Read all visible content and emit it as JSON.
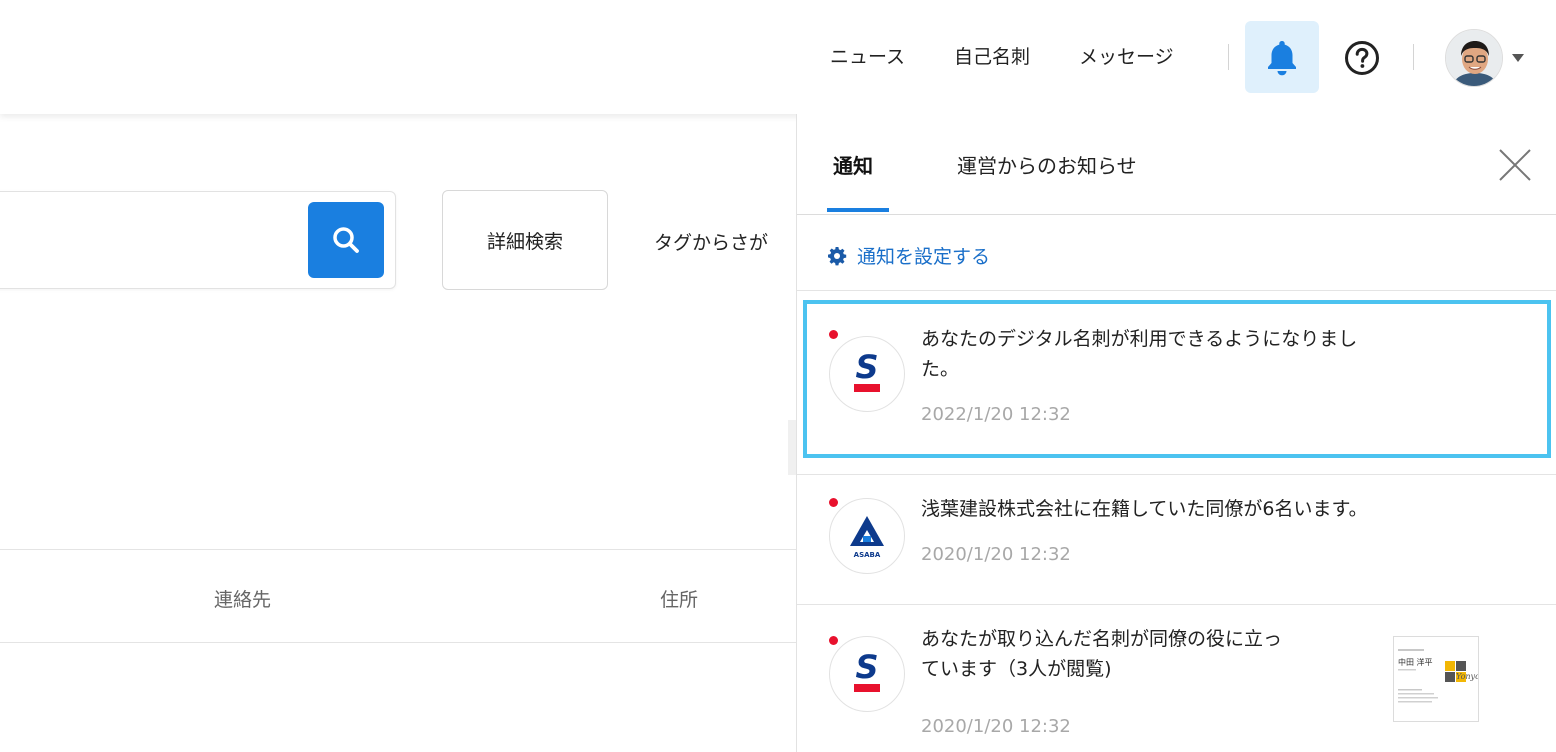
{
  "header": {
    "nav": [
      "ニュース",
      "自己名刺",
      "メッセージ"
    ],
    "accent_color": "#1a7fe0"
  },
  "search": {
    "advanced_label": "詳細検索",
    "tag_label": "タグからさが"
  },
  "table": {
    "columns": [
      "連絡先",
      "住所"
    ]
  },
  "panel": {
    "tabs": [
      "通知",
      "運営からのお知らせ"
    ],
    "settings_label": "通知を設定する",
    "notifications": [
      {
        "line1": "あなたのデジタル名刺が利用できるようになりまし",
        "line2": "た。",
        "time": "2022/1/20 12:32",
        "logo": "sansan-s-logo",
        "unread": true,
        "highlighted": true
      },
      {
        "line1": "浅葉建設株式会社に在籍していた同僚が6名います。",
        "line2": "",
        "time": "2020/1/20 12:32",
        "logo": "asaba-logo",
        "logo_text": "ASABA",
        "unread": true,
        "highlighted": false
      },
      {
        "line1": "あなたが取り込んだ名刺が同僚の役に立っ",
        "line2": "ています（3人が閲覧)",
        "time": "2020/1/20 12:32",
        "logo": "sansan-s-logo",
        "unread": true,
        "highlighted": false,
        "card": {
          "name": "中田 洋平",
          "brand": "Yonyon"
        }
      }
    ]
  }
}
